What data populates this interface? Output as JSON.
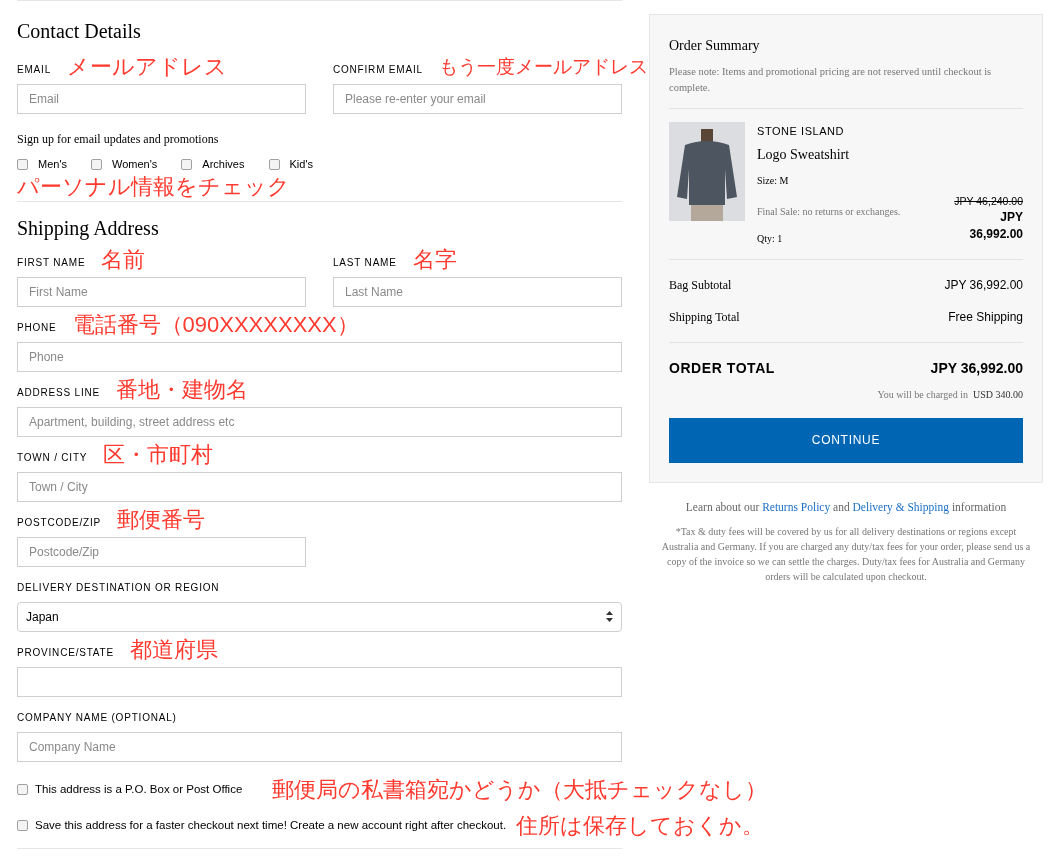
{
  "contact": {
    "heading": "Contact Details",
    "fields": [
      {
        "kind": "input",
        "label": "EMAIL",
        "annotation": "メールアドレス",
        "placeholder": "Email"
      },
      {
        "kind": "input",
        "label": "CONFIRM EMAIL",
        "annotation": "もう一度メールアドレス",
        "placeholder": "Please re-enter your email"
      }
    ],
    "signup_text": "Sign up for email updates and promotions",
    "signup_options": [
      {
        "label": "Men's",
        "checked": false
      },
      {
        "label": "Women's",
        "checked": false
      },
      {
        "label": "Archives",
        "checked": false
      },
      {
        "label": "Kid's",
        "checked": false
      }
    ],
    "annotation": "パーソナル情報をチェック"
  },
  "shipping": {
    "heading": "Shipping Address",
    "rows": [
      [
        {
          "kind": "input",
          "label": "FIRST NAME",
          "annotation": "名前",
          "placeholder": "First Name"
        },
        {
          "kind": "input",
          "label": "LAST NAME",
          "annotation": "名字",
          "placeholder": "Last Name"
        }
      ],
      [
        {
          "kind": "input",
          "label": "PHONE",
          "annotation": "電話番号（090XXXXXXXX）",
          "placeholder": "Phone"
        }
      ],
      [
        {
          "kind": "input",
          "label": "ADDRESS LINE",
          "annotation": "番地・建物名",
          "placeholder": "Apartment, building, street address etc"
        }
      ],
      [
        {
          "kind": "input",
          "label": "TOWN / CITY",
          "annotation": "区・市町村",
          "placeholder": "Town / City"
        }
      ],
      [
        {
          "kind": "short_input",
          "label": "POSTCODE/ZIP",
          "annotation": "郵便番号",
          "placeholder": "Postcode/Zip"
        }
      ],
      [
        {
          "kind": "select",
          "label": "DELIVERY DESTINATION OR REGION",
          "value": "Japan"
        }
      ],
      [
        {
          "kind": "input",
          "label": "PROVINCE/STATE",
          "annotation": "都道府県"
        }
      ],
      [
        {
          "kind": "input",
          "label": "COMPANY NAME (OPTIONAL)",
          "placeholder": "Company Name"
        }
      ]
    ],
    "options": [
      {
        "label": "This address is a P.O. Box or Post Office",
        "checked": false,
        "annotation": "郵便局の私書箱宛かどうか（大抵チェックなし）"
      },
      {
        "label": "Save this address for a faster checkout next time! Create a new account right after checkout.",
        "checked": false,
        "annotation": "住所は保存しておくか。"
      }
    ]
  },
  "summary": {
    "title": "Order Summary",
    "note": "Please note: Items and promotional pricing are not reserved until checkout is complete.",
    "item": {
      "brand": "STONE ISLAND",
      "name": "Logo Sweatshirt",
      "size": "Size: M",
      "final_sale": "Final Sale: no returns or exchanges.",
      "qty": "Qty: 1",
      "original_price": "JPY 46,240.00",
      "price": "JPY 36,992.00"
    },
    "lines": [
      {
        "label": "Bag Subtotal",
        "value": "JPY 36,992.00"
      },
      {
        "label": "Shipping Total",
        "value": "Free Shipping"
      }
    ],
    "total": {
      "label": "ORDER TOTAL",
      "value": "JPY 36,992.00"
    },
    "charged": {
      "label": "You will be charged in",
      "value": "USD 340.00"
    },
    "button": "CONTINUE"
  },
  "footer": {
    "learn": [
      {
        "kind": "text",
        "text": "Learn about our"
      },
      {
        "kind": "link",
        "text": "Returns Policy"
      },
      {
        "kind": "text",
        "text": "and"
      },
      {
        "kind": "link",
        "text": "Delivery & Shipping"
      },
      {
        "kind": "text",
        "text": "information"
      }
    ],
    "tax_note": "*Tax & duty fees will be covered by us for all delivery destinations or regions except Australia and Germany. If you are charged any duty/tax fees for your order, please send us a copy of the invoice so we can settle the charges. Duty/tax fees for Australia and Germany orders will be calculated upon checkout."
  }
}
